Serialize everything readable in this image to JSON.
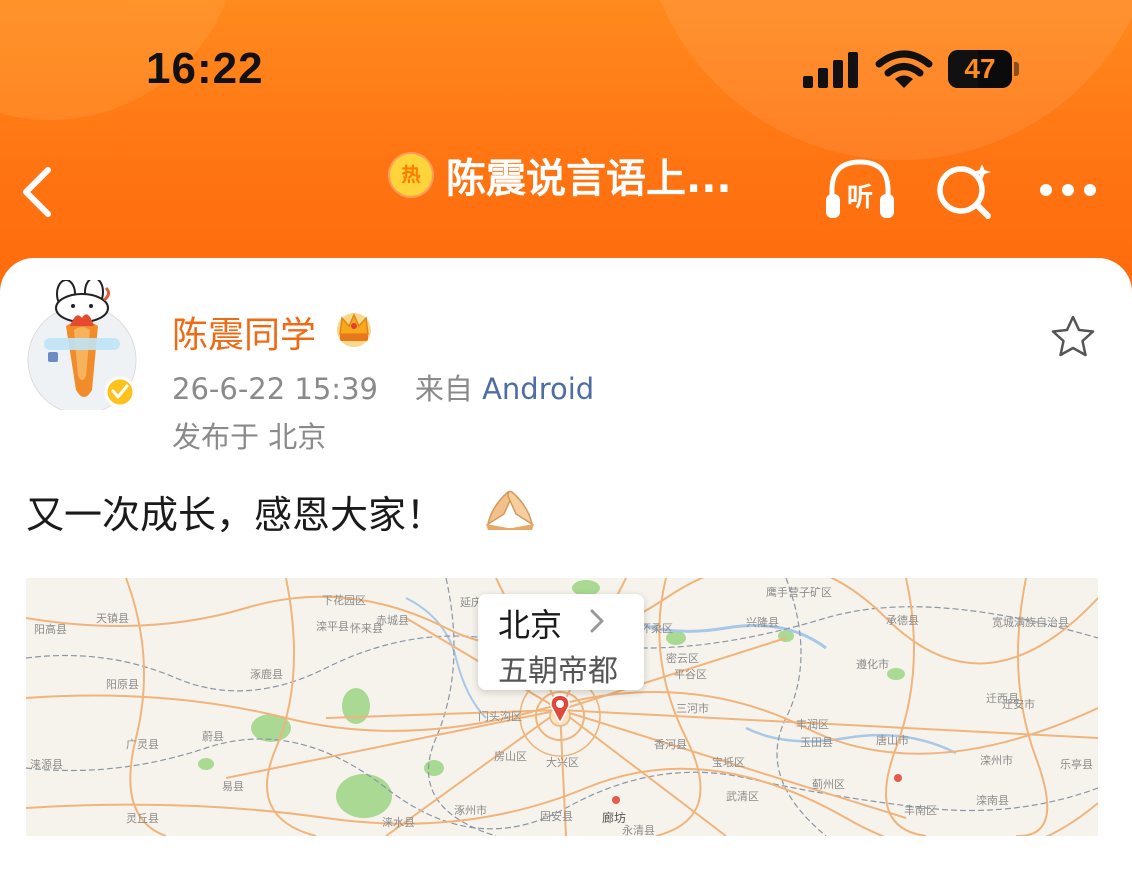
{
  "status_bar": {
    "time": "16:22",
    "battery_percent": "47",
    "battery_level": 0.47,
    "icons": [
      "cellular-signal-icon",
      "wifi-icon",
      "battery-icon"
    ]
  },
  "nav": {
    "back_icon": "chevron-left-icon",
    "hot_badge": "热",
    "title": "陈震说言语上...",
    "actions": [
      "listen-icon",
      "search-icon",
      "more-icon"
    ],
    "listen_glyph": "听"
  },
  "post": {
    "username": "陈震同学",
    "badge_icon": "crown-icon",
    "timestamp": "26-6-22 15:39",
    "source_prefix": "来自",
    "source": "Android",
    "location": "发布于 北京",
    "text": "又一次成长，感恩大家！",
    "emoji_icon": "pray-hands-icon",
    "favorite_icon": "star-icon",
    "verified_icon": "verified-badge-icon"
  },
  "map": {
    "city": "北京",
    "subtitle": "五朝帝都",
    "chevron_icon": "chevron-right-icon",
    "labels": [
      "阳高县",
      "天镇县",
      "下花园区",
      "赤城县",
      "滦平县",
      "鹰手营子矿区",
      "兴隆县",
      "怀来县",
      "延庆区",
      "怀柔区",
      "密云区",
      "承德县",
      "宽城满族自治县",
      "迁西县",
      "阳原县",
      "涿鹿县",
      "平谷区",
      "遵化市",
      "迁安市",
      "门头沟区",
      "三河市",
      "丰润区",
      "唐山市",
      "广灵县",
      "蔚县",
      "房山区",
      "涿州市",
      "大兴区",
      "固安县",
      "廊坊",
      "香河县",
      "宝坻区",
      "玉田县",
      "滦州市",
      "乐亭县",
      "涞源县",
      "易县",
      "灵丘县",
      "涞水县",
      "永清县",
      "武清区",
      "丰南区",
      "滦南县",
      "蓟州区"
    ],
    "colors": {
      "road": "#f0b47d",
      "water": "#a8c8e8",
      "green": "#9fd389",
      "admin": "#8a96a6"
    }
  },
  "theme": {
    "accent": "#ff7412",
    "username_color": "#f06a16",
    "source_color": "#4d6da3"
  }
}
